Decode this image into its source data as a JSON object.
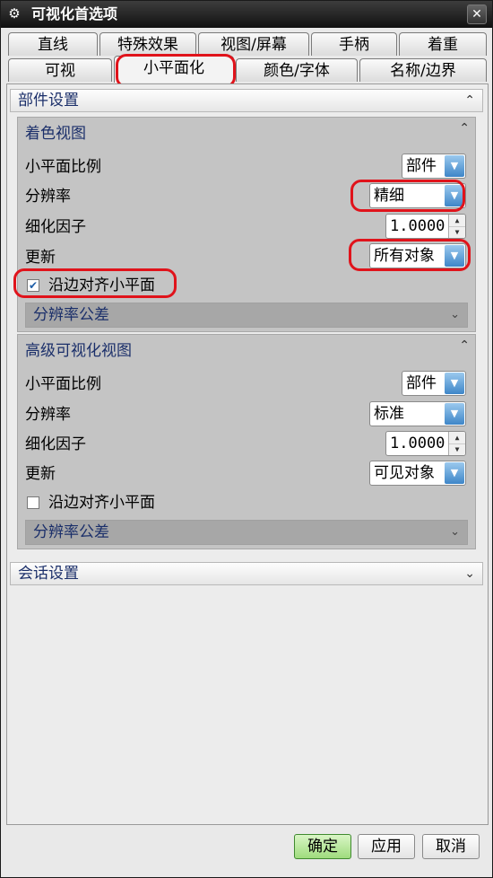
{
  "window": {
    "title": "可视化首选项",
    "app_icon": "gear-icon",
    "close_label": "✕"
  },
  "tabs": {
    "row1": [
      "直线",
      "特殊效果",
      "视图/屏幕",
      "手柄",
      "着重"
    ],
    "row2": [
      "可视",
      "小平面化",
      "颜色/字体",
      "名称/边界"
    ],
    "active": "小平面化"
  },
  "part_settings": {
    "title": "部件设置",
    "shaded_view": {
      "title": "着色视图",
      "facet_scale_label": "小平面比例",
      "facet_scale_value": "部件",
      "resolution_label": "分辨率",
      "resolution_value": "精细",
      "refine_factor_label": "细化因子",
      "refine_factor_value": "1.0000",
      "update_label": "更新",
      "update_value": "所有对象",
      "align_edges_label": "沿边对齐小平面",
      "align_edges_checked": true,
      "tolerance_title": "分辨率公差"
    },
    "advanced_view": {
      "title": "高级可视化视图",
      "facet_scale_label": "小平面比例",
      "facet_scale_value": "部件",
      "resolution_label": "分辨率",
      "resolution_value": "标准",
      "refine_factor_label": "细化因子",
      "refine_factor_value": "1.0000",
      "update_label": "更新",
      "update_value": "可见对象",
      "align_edges_label": "沿边对齐小平面",
      "align_edges_checked": false,
      "tolerance_title": "分辨率公差"
    }
  },
  "session_settings": {
    "title": "会话设置"
  },
  "buttons": {
    "ok": "确定",
    "apply": "应用",
    "cancel": "取消"
  },
  "colors": {
    "highlight": "#e0131b",
    "ok_button": "#9fdc7d",
    "dropdown_arrow": "#3e86c8"
  }
}
